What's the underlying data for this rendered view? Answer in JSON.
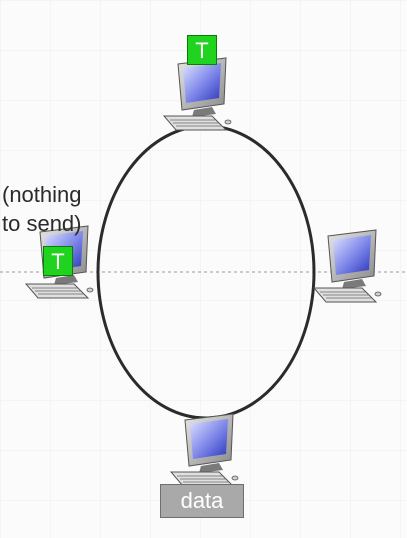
{
  "annotation": {
    "line1": "(nothing",
    "line2": "to send)"
  },
  "tokens": {
    "top": "T",
    "left": "T"
  },
  "data_label": "data",
  "icons": {
    "computer": "computer-icon"
  },
  "colors": {
    "token": "#1fd31f",
    "ring": "#2b2b2b",
    "data_box": "#a9a9a9"
  }
}
